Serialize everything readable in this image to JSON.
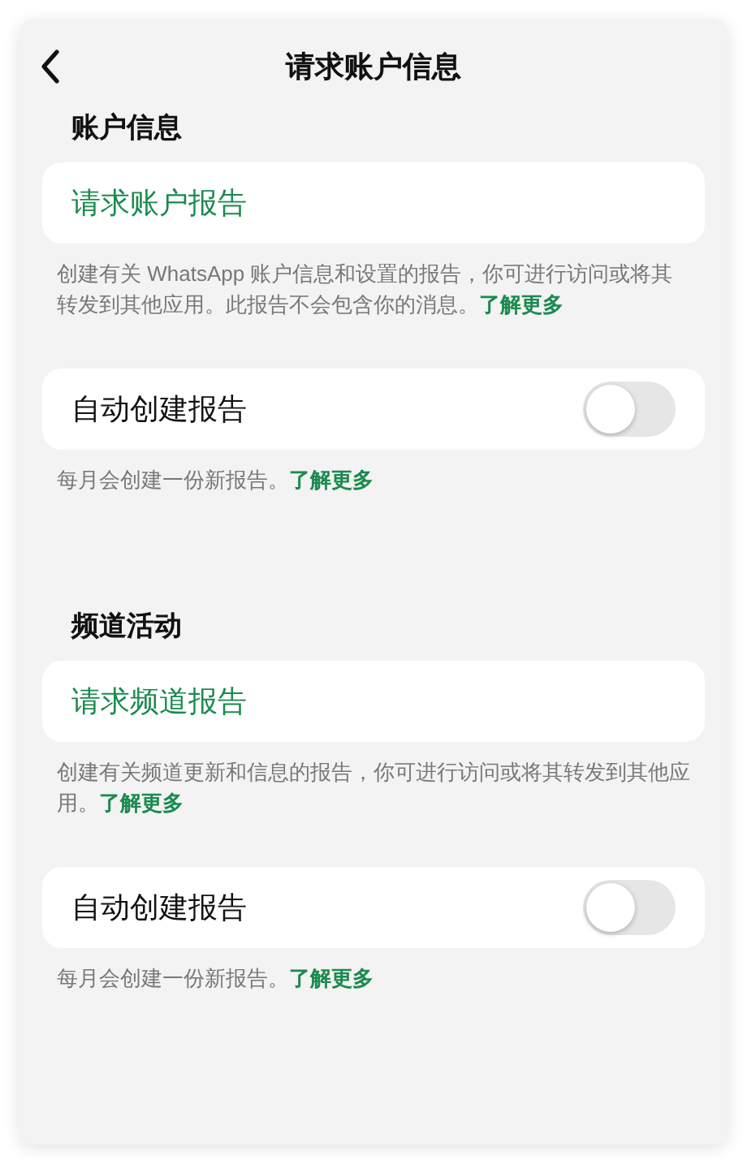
{
  "header": {
    "title": "请求账户信息"
  },
  "sections": [
    {
      "title": "账户信息",
      "request_button": "请求账户报告",
      "description": "创建有关 WhatsApp 账户信息和设置的报告，你可进行访问或将其转发到其他应用。此报告不会包含你的消息。",
      "description_link": "了解更多",
      "toggle": {
        "label": "自动创建报告",
        "on": false
      },
      "toggle_note": "每月会创建一份新报告。",
      "toggle_note_link": "了解更多"
    },
    {
      "title": "频道活动",
      "request_button": "请求频道报告",
      "description": "创建有关频道更新和信息的报告，你可进行访问或将其转发到其他应用。",
      "description_link": "了解更多",
      "toggle": {
        "label": "自动创建报告",
        "on": false
      },
      "toggle_note": "每月会创建一份新报告。",
      "toggle_note_link": "了解更多"
    }
  ]
}
